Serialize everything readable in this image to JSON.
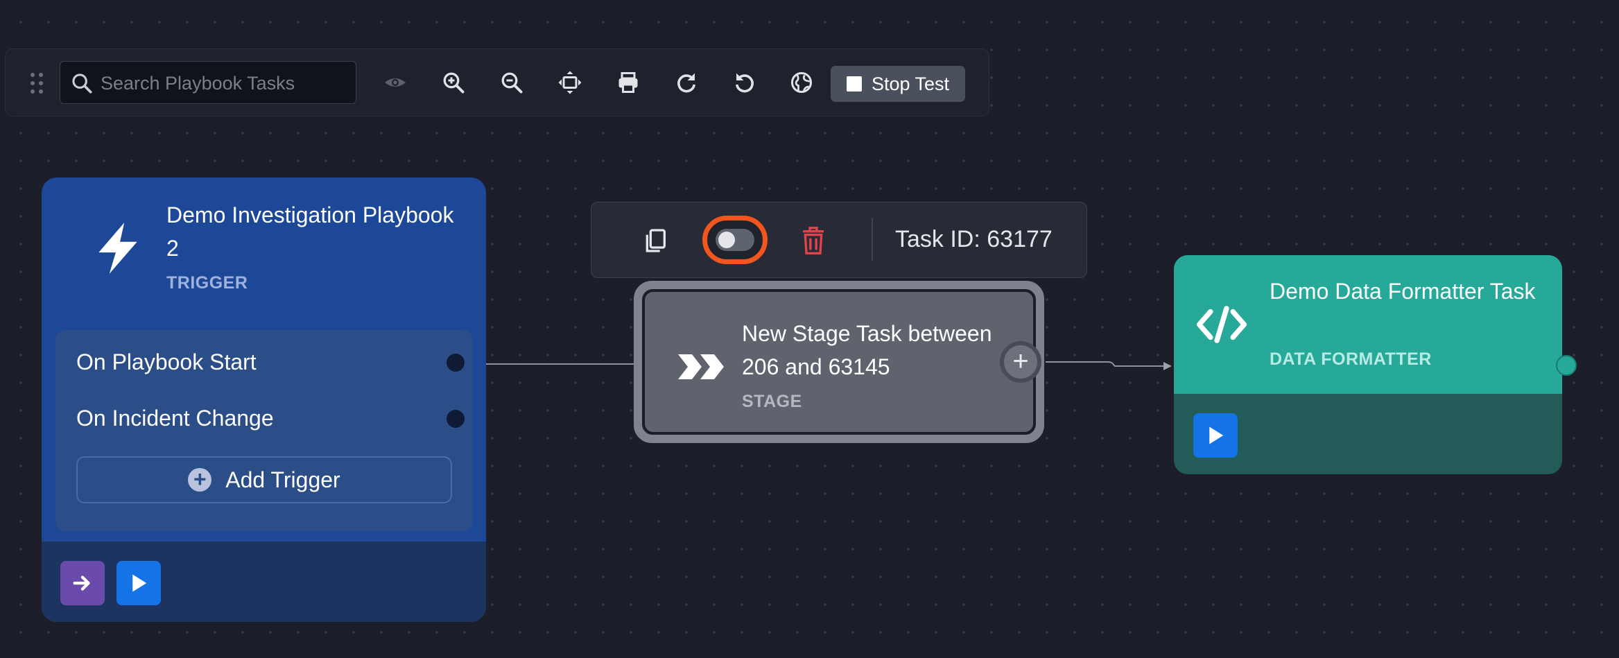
{
  "toolbar": {
    "search_placeholder": "Search Playbook Tasks",
    "stop_test_label": "Stop Test",
    "icons": [
      "drag-handle-icon",
      "search-icon",
      "eye-icon",
      "zoom-in-icon",
      "zoom-out-icon",
      "fit-view-icon",
      "print-icon",
      "redo-icon",
      "undo-icon",
      "globe-icon",
      "stop-icon"
    ]
  },
  "trigger_node": {
    "title": "Demo Investigation Playbook 2",
    "type": "TRIGGER",
    "triggers": [
      {
        "label": "On Playbook Start"
      },
      {
        "label": "On Incident Change"
      }
    ],
    "add_trigger_label": "Add Trigger",
    "colors": {
      "card": "#1d4898",
      "footer": "#1d3461",
      "arrow_button": "#6a4bab",
      "play_button": "#1473e6"
    }
  },
  "stage_toolbar": {
    "task_id_label": "Task ID: 63177",
    "icons": [
      "copy-icon",
      "toggle-switch",
      "trash-icon"
    ],
    "highlight_color": "#f0561e"
  },
  "stage_node": {
    "title": "New Stage Task between 206 and 63145",
    "type": "STAGE",
    "color": "#5e636e"
  },
  "formatter_node": {
    "title": "Demo Data Formatter Task",
    "type": "DATA FORMATTER",
    "colors": {
      "header": "#26a998",
      "body": "#235b58",
      "play_button": "#1473e6"
    }
  }
}
